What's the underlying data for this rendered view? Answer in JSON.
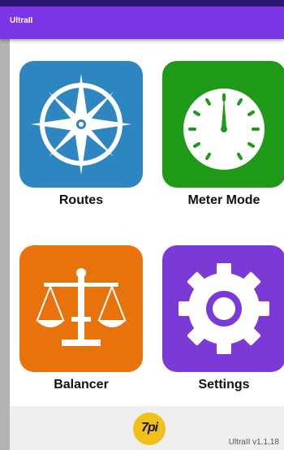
{
  "app": {
    "title": "UltraII"
  },
  "colors": {
    "app_bar": "#7c35e6",
    "routes_tile": "#2e86c1",
    "meter_tile": "#1e9a18",
    "balancer_tile": "#e8730c",
    "settings_tile": "#7b3ad6"
  },
  "tiles": [
    {
      "label": "Routes",
      "icon": "compass-icon"
    },
    {
      "label": "Meter Mode",
      "icon": "gauge-icon"
    },
    {
      "label": "Balancer",
      "icon": "scale-icon"
    },
    {
      "label": "Settings",
      "icon": "gear-icon"
    }
  ],
  "footer": {
    "logo_text": "7pi",
    "version": "UltraII v1.1.18"
  }
}
